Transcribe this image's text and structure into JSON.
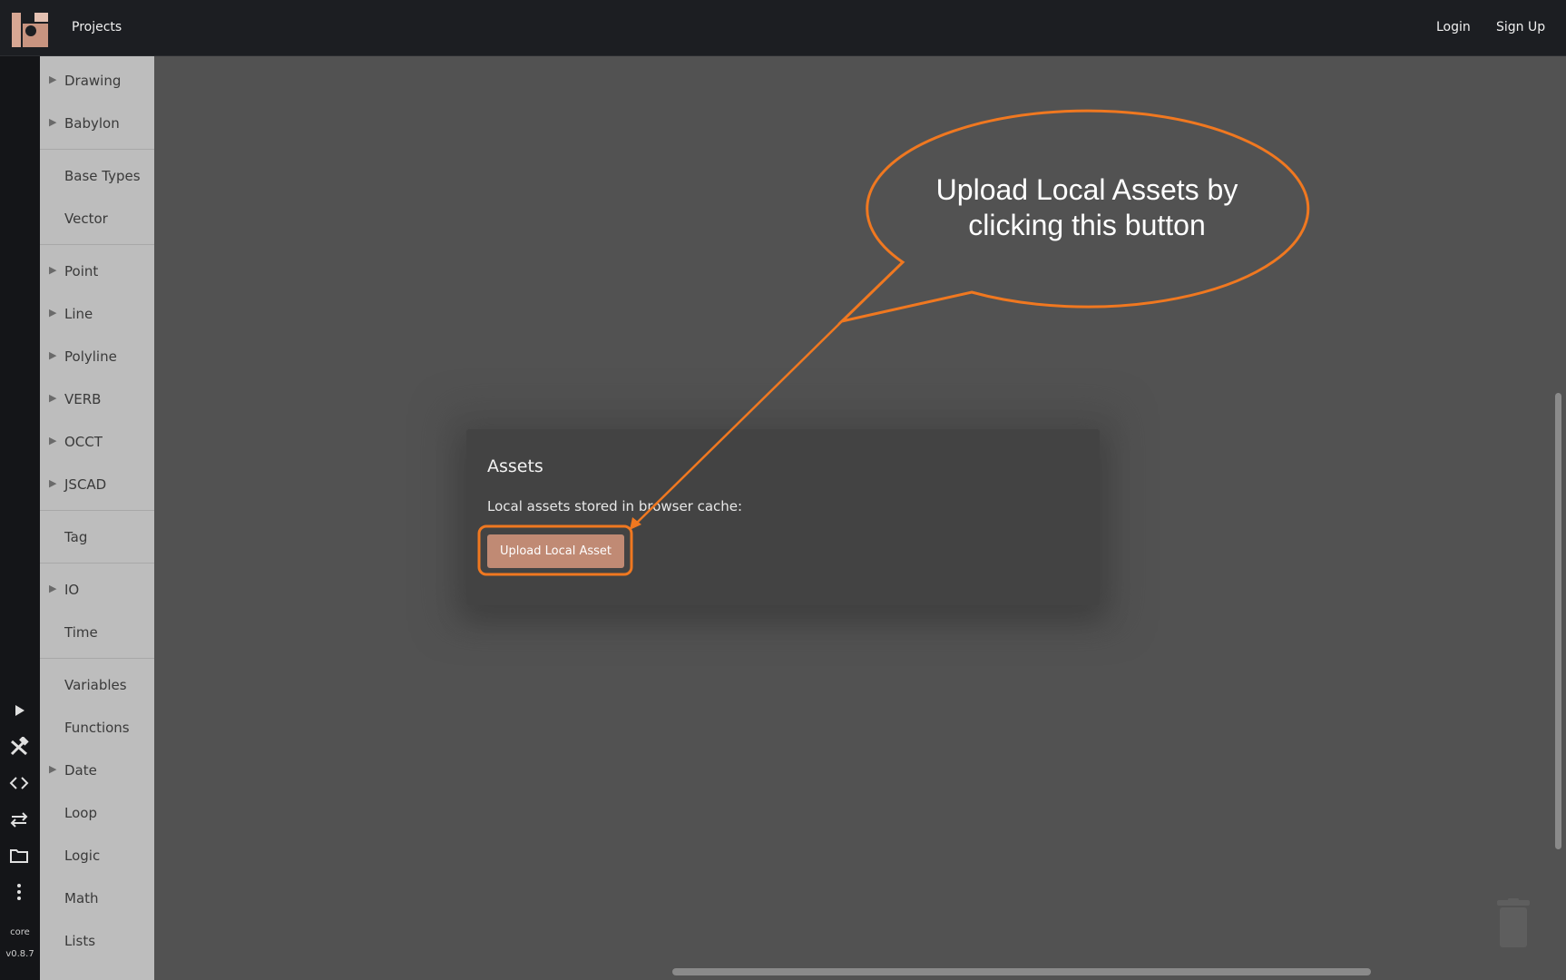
{
  "header": {
    "nav_projects": "Projects",
    "login": "Login",
    "signup": "Sign Up"
  },
  "iconbar": {
    "icons": [
      "play-icon",
      "tools-icon",
      "code-icon",
      "swap-icon",
      "folder-icon",
      "more-icon"
    ],
    "core_label": "core",
    "version": "v0.8.7"
  },
  "sidebar": {
    "items": [
      {
        "label": "Drawing",
        "expandable": true
      },
      {
        "label": "Babylon",
        "expandable": true
      },
      {
        "label": "Base Types",
        "expandable": false
      },
      {
        "label": "Vector",
        "expandable": false
      },
      {
        "label": "Point",
        "expandable": true
      },
      {
        "label": "Line",
        "expandable": true
      },
      {
        "label": "Polyline",
        "expandable": true
      },
      {
        "label": "VERB",
        "expandable": true
      },
      {
        "label": "OCCT",
        "expandable": true
      },
      {
        "label": "JSCAD",
        "expandable": true
      },
      {
        "label": "Tag",
        "expandable": false
      },
      {
        "label": "IO",
        "expandable": true
      },
      {
        "label": "Time",
        "expandable": false
      },
      {
        "label": "Variables",
        "expandable": false
      },
      {
        "label": "Functions",
        "expandable": false
      },
      {
        "label": "Date",
        "expandable": true
      },
      {
        "label": "Loop",
        "expandable": false
      },
      {
        "label": "Logic",
        "expandable": false
      },
      {
        "label": "Math",
        "expandable": false
      },
      {
        "label": "Lists",
        "expandable": false
      }
    ]
  },
  "dialog": {
    "title": "Assets",
    "description": "Local assets stored in browser cache:",
    "upload_button": "Upload Local Asset"
  },
  "callout": {
    "line1": "Upload Local Assets by",
    "line2": "clicking this button",
    "color": "#f07820"
  },
  "colors": {
    "accent": "#c08a74",
    "canvas": "#525252",
    "topbar": "#1c1e22"
  }
}
